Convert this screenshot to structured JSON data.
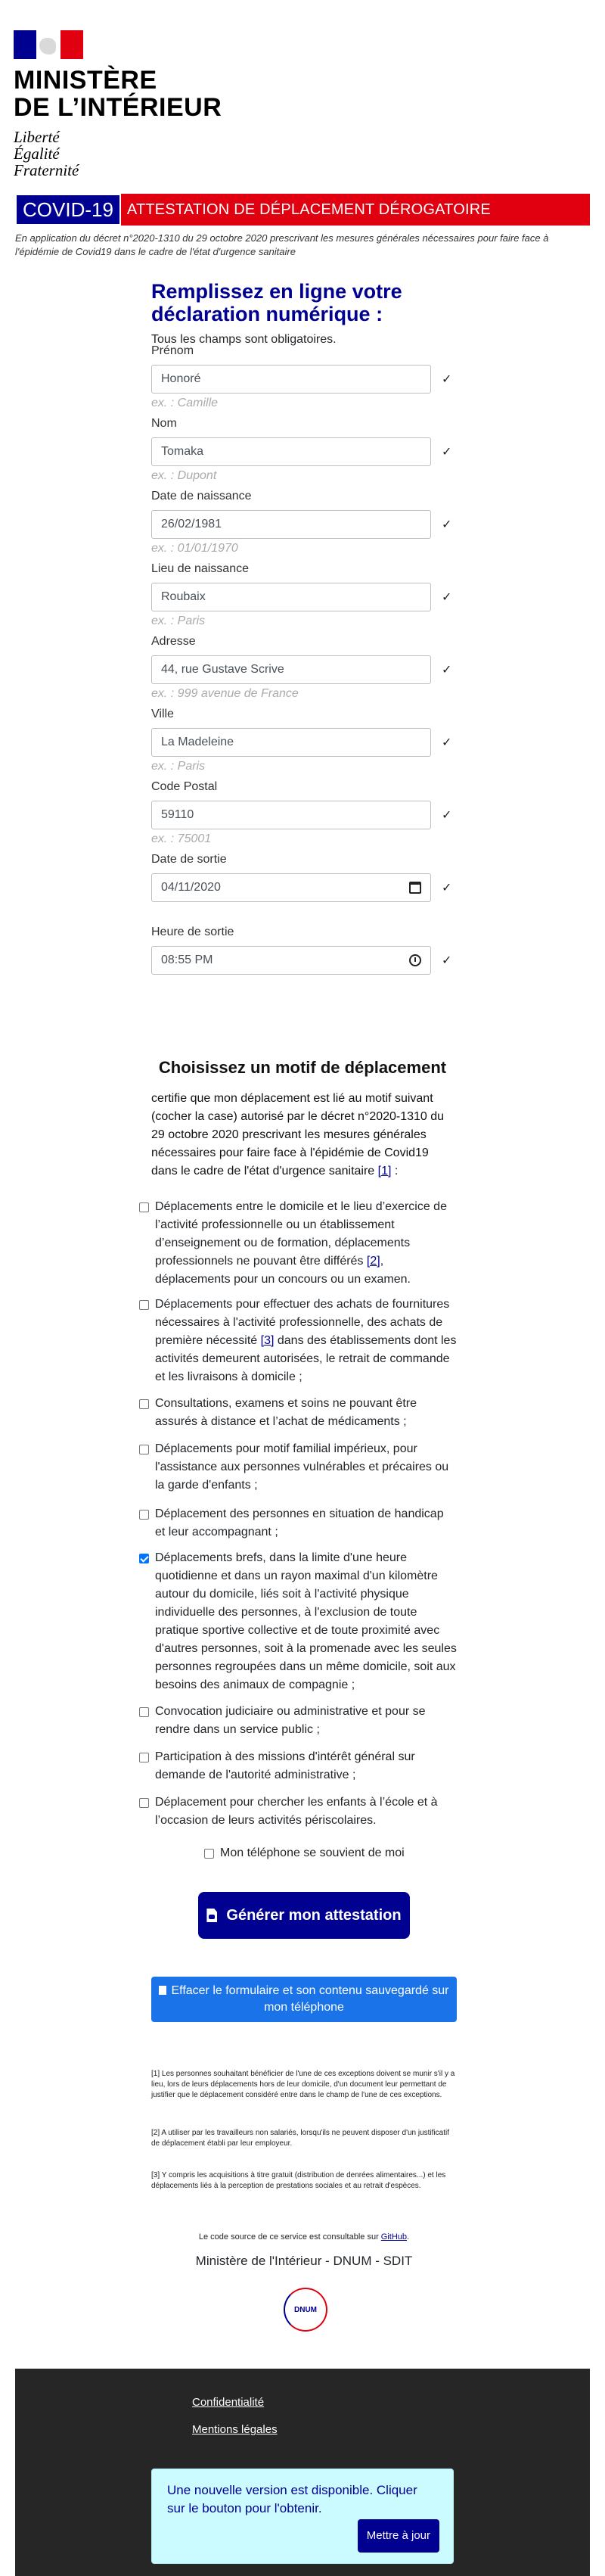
{
  "header": {
    "ministry_line1": "MINISTÈRE",
    "ministry_line2": "DE L’INTÉRIEUR",
    "motto": [
      "Liberté",
      "Égalité",
      "Fraternité"
    ],
    "banner_covid": "COVID-19",
    "banner_title": "ATTESTATION DE DÉPLACEMENT DÉROGATOIRE",
    "decree": "En application du décret n°2020-1310 du 29 octobre 2020 prescrivant les mesures générales nécessaires pour faire face à l'épidémie de Covid19 dans le cadre de l'état d'urgence sanitaire"
  },
  "form": {
    "title": "Remplissez en ligne votre déclaration numérique :",
    "required_note": "Tous les champs sont obligatoires.",
    "fields": [
      {
        "label": "Prénom",
        "value": "Honoré",
        "example": "ex. : Camille"
      },
      {
        "label": "Nom",
        "value": "Tomaka",
        "example": "ex. : Dupont"
      },
      {
        "label": "Date de naissance",
        "value": "26/02/1981",
        "example": "ex. : 01/01/1970"
      },
      {
        "label": "Lieu de naissance",
        "value": "Roubaix",
        "example": "ex. : Paris"
      },
      {
        "label": "Adresse",
        "value": "44, rue Gustave Scrive",
        "example": "ex. : 999 avenue de France"
      },
      {
        "label": "Ville",
        "value": "La Madeleine",
        "example": "ex. : Paris"
      },
      {
        "label": "Code Postal",
        "value": "59110",
        "example": "ex. : 75001"
      },
      {
        "label": "Date de sortie",
        "value": "04/11/2020",
        "example": ""
      },
      {
        "label": "Heure de sortie",
        "value": "08:55 PM",
        "example": ""
      }
    ],
    "check_mark": "✓"
  },
  "motifs": {
    "title": "Choisissez un motif de déplacement",
    "intro": "certifie que mon déplacement est lié au motif suivant (cocher la case) autorisé par le décret n°2020-1310 du 29 octobre 2020 prescrivant les mesures générales nécessaires pour faire face à l'épidémie de Covid19 dans le cadre de l'état d'urgence sanitaire",
    "intro_ref": "[1]",
    "intro_end": " :",
    "reasons": [
      {
        "text_a": "Déplacements entre le domicile et le lieu d’exercice de l’activité professionnelle ou un établissement d’enseignement ou de formation, déplacements professionnels ne pouvant être différés ",
        "ref": "[2]",
        "text_b": ", déplacements pour un concours ou un examen.",
        "checked": false
      },
      {
        "text_a": "Déplacements pour effectuer des achats de fournitures nécessaires à l'activité professionnelle, des achats de première nécessité ",
        "ref": "[3]",
        "text_b": " dans des établissements dont les activités demeurent autorisées, le retrait de commande et les livraisons à domicile ;",
        "checked": false
      },
      {
        "text_a": "Consultations, examens et soins ne pouvant être assurés à distance et l’achat de médicaments ;",
        "ref": "",
        "text_b": "",
        "checked": false
      },
      {
        "text_a": "Déplacements pour motif familial impérieux, pour l'assistance aux personnes vulnérables et précaires ou la garde d'enfants ;",
        "ref": "",
        "text_b": "",
        "checked": false
      },
      {
        "text_a": "Déplacement des personnes en situation de handicap et leur accompagnant ;",
        "ref": "",
        "text_b": "",
        "checked": false
      },
      {
        "text_a": "Déplacements brefs, dans la limite d'une heure quotidienne et dans un rayon maximal d'un kilomètre autour du domicile, liés soit à l'activité physique individuelle des personnes, à l'exclusion de toute pratique sportive collective et de toute proximité avec d'autres personnes, soit à la promenade avec les seules personnes regroupées dans un même domicile, soit aux besoins des animaux de compagnie ;",
        "ref": "",
        "text_b": "",
        "checked": true
      },
      {
        "text_a": "Convocation judiciaire ou administrative et pour se rendre dans un service public ;",
        "ref": "",
        "text_b": "",
        "checked": false
      },
      {
        "text_a": "Participation à des missions d'intérêt général sur demande de l'autorité administrative ;",
        "ref": "",
        "text_b": "",
        "checked": false
      },
      {
        "text_a": "Déplacement pour chercher les enfants à l’école et à l’occasion de leurs activités périscolaires.",
        "ref": "",
        "text_b": "",
        "checked": false
      }
    ]
  },
  "actions": {
    "remember_label": "Mon téléphone se souvient de moi",
    "generate_label": "Générer mon attestation",
    "clear_label": "Effacer le formulaire et son contenu sauvegardé sur mon téléphone"
  },
  "footnotes": [
    "[1] Les personnes souhaitant bénéficier de l'une de ces exceptions doivent se munir s'il y a lieu, lors de leurs déplacements hors de leur domicile, d'un document leur permettant de justifier que le déplacement considéré entre dans le champ de l'une de ces exceptions.",
    "[2] A utiliser par les travailleurs non salariés, lorsqu'ils ne peuvent disposer d'un justificatif de déplacement établi par leur employeur.",
    "[3] Y compris les acquisitions à titre gratuit (distribution de denrées alimentaires...) et les déplacements liés à la perception de prestations sociales et au retrait d'espèces."
  ],
  "source": {
    "text": "Le code source de ce service est consultable sur ",
    "link": "GitHub",
    "end": "."
  },
  "signature": "Ministère de l'Intérieur - DNUM - SDIT",
  "dnum_label": "DNUM",
  "footer": {
    "privacy": "Confidentialité",
    "legal": "Mentions légales",
    "update_text": "Une nouvelle version est disponible. Cliquer sur le bouton pour l'obtenir.",
    "update_button": "Mettre à jour"
  }
}
